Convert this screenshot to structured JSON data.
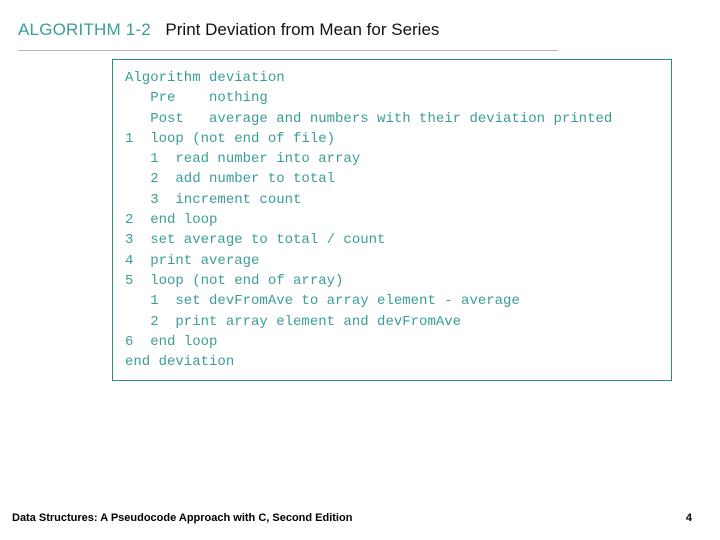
{
  "header": {
    "label": "ALGORITHM 1-2",
    "title": "Print Deviation from Mean for Series"
  },
  "code": {
    "lines": [
      "Algorithm deviation",
      "   Pre    nothing",
      "   Post   average and numbers with their deviation printed",
      "1  loop (not end of file)",
      "   1  read number into array",
      "   2  add number to total",
      "   3  increment count",
      "2  end loop",
      "3  set average to total / count",
      "4  print average",
      "5  loop (not end of array)",
      "   1  set devFromAve to array element - average",
      "   2  print array element and devFromAve",
      "6  end loop",
      "end deviation"
    ]
  },
  "footer": {
    "book": "Data Structures: A Pseudocode Approach with C, Second Edition",
    "page": "4"
  }
}
